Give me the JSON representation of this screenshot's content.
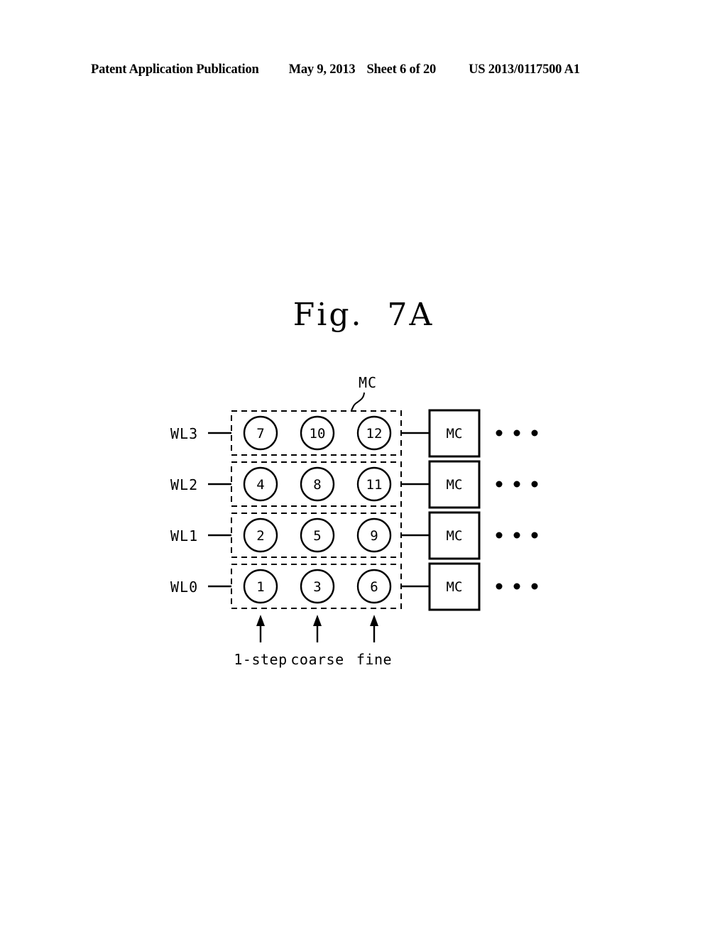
{
  "header": {
    "publication": "Patent Application Publication",
    "date": "May 9, 2013",
    "sheet": "Sheet 6 of 20",
    "number": "US 2013/0117500 A1"
  },
  "figure": {
    "title": "Fig.  7A",
    "callout_label": "MC"
  },
  "diagram": {
    "wordline_labels": [
      "WL3",
      "WL2",
      "WL1",
      "WL0"
    ],
    "rows": [
      {
        "wordline": "WL3",
        "cells": [
          "7",
          "10",
          "12"
        ],
        "block_label": "MC",
        "ellipsis": "• • •"
      },
      {
        "wordline": "WL2",
        "cells": [
          "4",
          "8",
          "11"
        ],
        "block_label": "MC",
        "ellipsis": "• • •"
      },
      {
        "wordline": "WL1",
        "cells": [
          "2",
          "5",
          "9"
        ],
        "block_label": "MC",
        "ellipsis": "• • •"
      },
      {
        "wordline": "WL0",
        "cells": [
          "1",
          "3",
          "6"
        ],
        "block_label": "MC",
        "ellipsis": "• • •"
      }
    ],
    "column_labels": [
      "1-step",
      "coarse",
      "fine"
    ],
    "colors": {
      "ink": "#000000",
      "paper": "#ffffff"
    }
  },
  "chart_data": {
    "type": "diagram",
    "title": "Fig. 7A",
    "description": "Memory cell programming order grid: rows are wordlines WL0-WL3, columns are program steps 1-step, coarse, fine. Each circle holds the program sequence number.",
    "row_labels": [
      "WL3",
      "WL2",
      "WL1",
      "WL0"
    ],
    "column_labels": [
      "1-step",
      "coarse",
      "fine"
    ],
    "values": [
      [
        7,
        10,
        12
      ],
      [
        4,
        8,
        11
      ],
      [
        2,
        5,
        9
      ],
      [
        1,
        3,
        6
      ]
    ],
    "trailing_block_label": "MC",
    "callout_label": "MC"
  }
}
